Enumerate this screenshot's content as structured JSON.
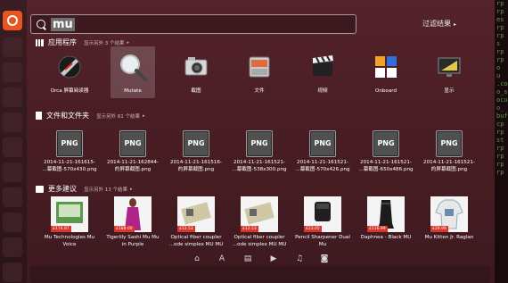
{
  "search": {
    "query": "mu"
  },
  "filter": {
    "label": "过滤结果"
  },
  "sections": {
    "apps": {
      "title": "应用程序",
      "more": "显示另外 3 个结果"
    },
    "files": {
      "title": "文件和文件夹",
      "more": "显示另外 81 个结果"
    },
    "more": {
      "title": "更多建议",
      "more": "显示另外 13 个结果"
    }
  },
  "apps": [
    {
      "label": "Orca 屏幕阅读器",
      "icon": "orca-icon"
    },
    {
      "label": "Mutate",
      "icon": "magnifier-icon"
    },
    {
      "label": "截图",
      "icon": "camera-icon"
    },
    {
      "label": "文件",
      "icon": "file-cabinet-icon"
    },
    {
      "label": "视频",
      "icon": "clapperboard-icon"
    },
    {
      "label": "Onboard",
      "icon": "keyboard-icon"
    },
    {
      "label": "显示",
      "icon": "display-icon"
    }
  ],
  "files": [
    {
      "badge": "PNG",
      "line1": "2014-11-21-161615-",
      "line2": "...幕截图-570x430.png"
    },
    {
      "badge": "PNG",
      "line1": "2014-11-21-162844-",
      "line2": "的屏幕截图.png"
    },
    {
      "badge": "PNG",
      "line1": "2014-11-21-161516-",
      "line2": "的屏幕截图.png"
    },
    {
      "badge": "PNG",
      "line1": "2014-11-21-161521-",
      "line2": "...幕截图-538x300.png"
    },
    {
      "badge": "PNG",
      "line1": "2014-11-21-161521-",
      "line2": "...幕截图-570x426.png"
    },
    {
      "badge": "PNG",
      "line1": "2014-11-21-161521-",
      "line2": "...幕截图-650x486.png"
    },
    {
      "badge": "PNG",
      "line1": "2014-11-21-161521-",
      "line2": "的屏幕截图.png"
    }
  ],
  "suggestions": [
    {
      "price": "£174.97",
      "line1": "Mu Technologies Mu",
      "line2": "Voice"
    },
    {
      "price": "£188.00",
      "line1": "Tigerlily Sashi Mu Mu",
      "line2": "in Purple"
    },
    {
      "price": "£12.53",
      "line1": "Optical fiber coupler",
      "line2": "...ode simplex MU MU"
    },
    {
      "price": "£12.53",
      "line1": "Optical fiber coupler",
      "line2": "...ode simplex MU MU"
    },
    {
      "price": "£23.05",
      "line1": "Pencil Sharpener Dual",
      "line2": "Mu"
    },
    {
      "price": "£116.99",
      "line1": "Daphnea - Black MU",
      "line2": ""
    },
    {
      "price": "£29.99",
      "line1": "Mu Kitten Jr. Raglan",
      "line2": ""
    }
  ],
  "lenses": [
    "home-icon",
    "apps-icon",
    "files-icon",
    "video-icon",
    "music-icon",
    "photo-icon"
  ],
  "terminal": [
    "rp",
    "rp",
    "es",
    "rp",
    "rp",
    "s",
    "rp",
    "",
    "",
    "",
    "rp",
    "o",
    "",
    "u",
    ".co",
    "o_s",
    "ocu",
    "o_",
    "buf",
    "cp",
    "rp",
    "st",
    "rp",
    "rp",
    "rp",
    "rp"
  ]
}
